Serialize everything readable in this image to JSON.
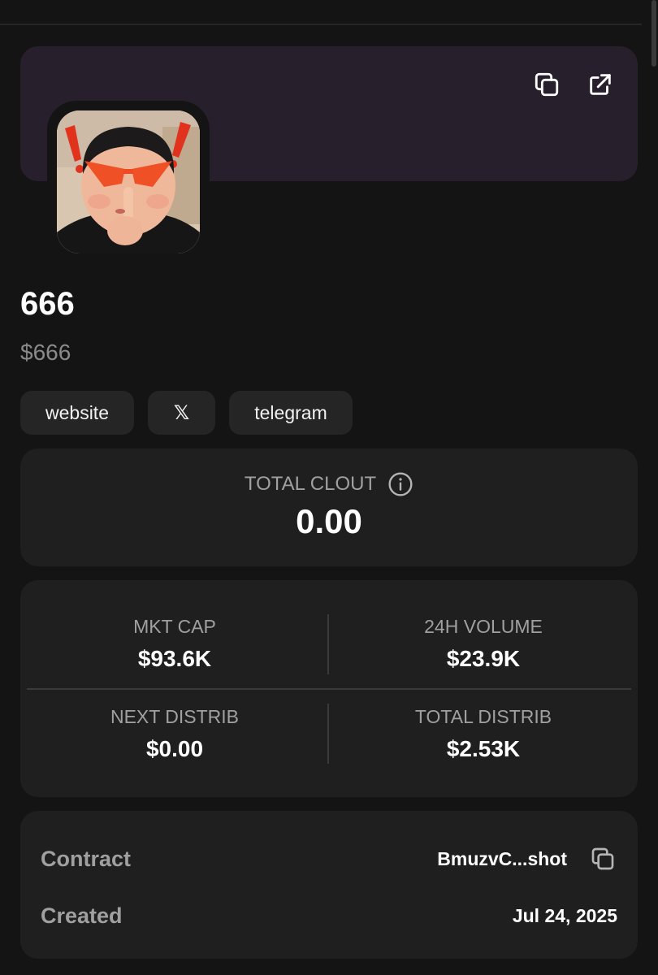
{
  "token": {
    "name": "666",
    "ticker": "$666"
  },
  "banner": {
    "background_color": "#271f2c",
    "actions": [
      {
        "icon": "copy-icon"
      },
      {
        "icon": "external-link-icon"
      }
    ]
  },
  "links": {
    "website": "website",
    "x": "𝕏",
    "telegram": "telegram"
  },
  "clout": {
    "label": "TOTAL CLOUT",
    "value": "0.00",
    "icon": "info-icon"
  },
  "stats": {
    "mkt_cap": {
      "label": "MKT CAP",
      "value": "$93.6K"
    },
    "volume_24h": {
      "label": "24H VOLUME",
      "value": "$23.9K"
    },
    "next_distrib": {
      "label": "NEXT DISTRIB",
      "value": "$0.00"
    },
    "total_distrib": {
      "label": "TOTAL DISTRIB",
      "value": "$2.53K"
    }
  },
  "details": {
    "contract": {
      "label": "Contract",
      "value": "BmuzvC...shot"
    },
    "created": {
      "label": "Created",
      "value": "Jul 24, 2025"
    }
  }
}
